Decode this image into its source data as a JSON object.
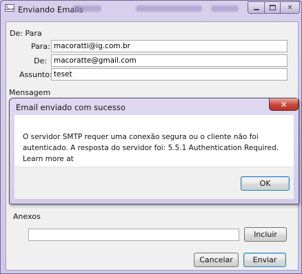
{
  "window": {
    "title": "Enviando Emails",
    "min_icon": "minimize-icon",
    "max_icon": "maximize-icon",
    "close_glyph": "✕"
  },
  "form": {
    "group_label": "De: Para",
    "para_label": "Para:",
    "para_value": "macoratti@ig.com.br",
    "de_label": "De:",
    "de_value": "macoratte@gmail.com",
    "assunto_label": "Assunto:",
    "assunto_value": "teset",
    "mensagem_label": "Mensagem",
    "anexos_label": "Anexos",
    "anexo_value": "",
    "incluir_label": "Incluir",
    "cancelar_label": "Cancelar",
    "enviar_label": "Enviar"
  },
  "dialog": {
    "title": "Email enviado com sucesso",
    "close_glyph": "✕",
    "message": "O servidor SMTP requer uma conexão segura ou o cliente não foi autenticado. A resposta do servidor foi: 5.5.1 Authentication Required. Learn more at",
    "ok_label": "OK"
  }
}
